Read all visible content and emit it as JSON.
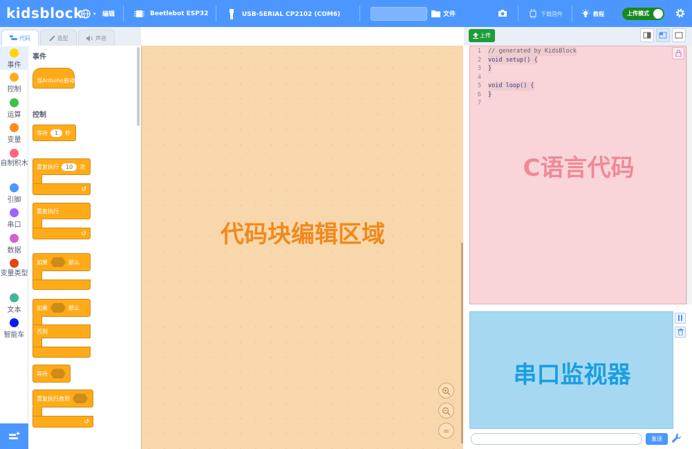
{
  "topbar": {
    "logo": "kidsblock",
    "edit_label": "编辑",
    "device_label": "Beetlebot ESP32",
    "port_label": "USB-SERIAL CP2102 (COM6)",
    "file_label": "文件",
    "download_firmware_label": "下载固件",
    "tutorial_label": "教程",
    "upload_mode_label": "上传模式",
    "icons": [
      "globe-icon",
      "chip-icon",
      "usb-icon",
      "folder-icon",
      "camera-icon",
      "firmware-icon",
      "lightbulb-icon",
      "gear-icon"
    ]
  },
  "tabs": [
    {
      "label": "代码",
      "icon": "code-icon",
      "active": true
    },
    {
      "label": "造型",
      "icon": "brush-icon",
      "active": false
    },
    {
      "label": "声音",
      "icon": "speaker-icon",
      "active": false
    }
  ],
  "categories": [
    {
      "label": "事件",
      "color": "#ffd500"
    },
    {
      "label": "控制",
      "color": "#ffab19"
    },
    {
      "label": "运算",
      "color": "#40bf4a"
    },
    {
      "label": "变量",
      "color": "#ff8c1a"
    },
    {
      "label": "自制积木",
      "color": "#ff6680"
    },
    {
      "label": "引脚",
      "color": "#4c97ff"
    },
    {
      "label": "串口",
      "color": "#9966ff"
    },
    {
      "label": "数据",
      "color": "#cf63cf"
    },
    {
      "label": "变量类型",
      "color": "#e6450f"
    },
    {
      "label": "文本",
      "color": "#3fb59a"
    },
    {
      "label": "智能车",
      "color": "#0b1bf5"
    }
  ],
  "palette": {
    "events_title": "事件",
    "when_arduino_starts": "当Arduino启动",
    "control_title": "控制",
    "wait_label": "等待",
    "wait_value": "1",
    "wait_unit": "秒",
    "repeat_label": "重复执行",
    "repeat_value": "10",
    "repeat_unit": "次",
    "forever_label": "重复执行",
    "if_label": "如果",
    "then_label": "那么",
    "if2_label": "如果",
    "then2_label": "那么",
    "else_label": "否则",
    "wait_until_label": "等待",
    "repeat_until_label": "重复执行直到"
  },
  "workspace": {
    "label": "代码块编辑区域",
    "zoom_in": "+",
    "zoom_out": "−",
    "zoom_reset": "="
  },
  "right": {
    "upload_label": "上传",
    "code_lines": [
      {
        "n": "1",
        "text": "// generated by KidsBlock"
      },
      {
        "n": "2",
        "text": "void setup() {"
      },
      {
        "n": "3",
        "text": "}"
      },
      {
        "n": "4",
        "text": ""
      },
      {
        "n": "5",
        "text": "void loop() {"
      },
      {
        "n": "6",
        "text": "}"
      },
      {
        "n": "7",
        "text": ""
      }
    ],
    "code_label": "C语言代码",
    "serial_label": "串口监视器",
    "send_label": "发送",
    "send_placeholder": ""
  },
  "colors": {
    "brand": "#4c97ff",
    "workspace_bg": "#f9d7ac",
    "code_bg": "#f9d5da",
    "serial_bg": "#a6d9f1",
    "upload_green": "#1e9c3a"
  }
}
